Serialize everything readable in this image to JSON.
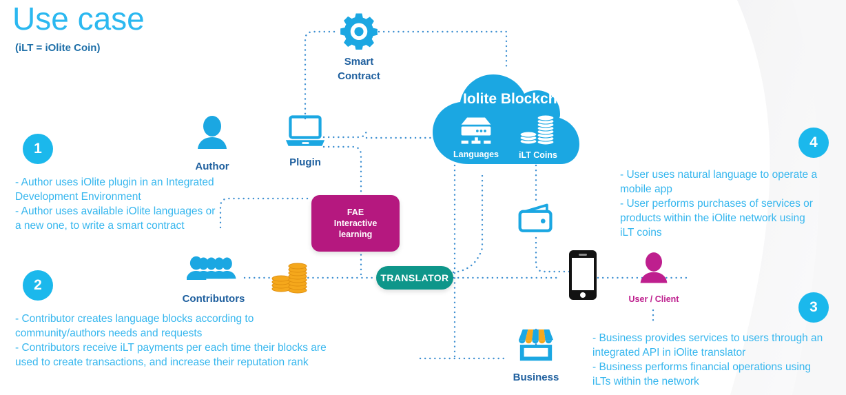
{
  "header": {
    "title": "Use case",
    "subtitle": "(iLT = iOlite Coin)"
  },
  "colors": {
    "title_blue": "#2BB8F0",
    "subtitle_blue": "#1E6FA8",
    "badge_cyan": "#1BB8EC",
    "body_text_blue": "#35B6EE",
    "node_label_blue": "#1E5F9E",
    "cloud_blue": "#1BA7E2",
    "fae_magenta": "#B5187F",
    "translator_teal": "#0E968A",
    "coin_orange": "#F5A81C",
    "user_magenta": "#BE1F8E",
    "phone_black": "#1A1A1A",
    "connector_blue": "#3D8FD1"
  },
  "steps": [
    {
      "number": "1",
      "lines": [
        "- Author uses iOlite plugin in an Integrated",
        "Development Environment",
        "- Author uses available iOlite languages or",
        "a new one, to write a smart contract"
      ]
    },
    {
      "number": "2",
      "lines": [
        "- Contributor creates language blocks according to",
        "community/authors needs and requests",
        "- Contributors receive iLT payments per each time their blocks are",
        "used to create transactions, and increase their reputation rank"
      ]
    },
    {
      "number": "3",
      "lines": [
        "- Business provides services to users through an",
        "integrated API in iOlite translator",
        "- Business performs financial operations using",
        "iLTs within the network"
      ]
    },
    {
      "number": "4",
      "lines": [
        "- User uses natural language to operate a",
        "mobile app",
        "- User performs purchases of services or",
        "products within the iOlite network using",
        "iLT coins"
      ]
    }
  ],
  "nodes": {
    "smart_contract": {
      "label_line1": "Smart",
      "label_line2": "Contract",
      "icon": "gear-icon"
    },
    "author": {
      "label": "Author",
      "icon": "person-icon"
    },
    "plugin": {
      "label": "Plugin",
      "icon": "laptop-icon"
    },
    "contributors": {
      "label": "Contributors",
      "icon": "people-group-icon"
    },
    "coins": {
      "icon": "coin-stack-icon"
    },
    "wallet": {
      "icon": "wallet-icon"
    },
    "phone": {
      "icon": "smartphone-icon"
    },
    "user_client": {
      "label": "User / Client",
      "icon": "person-icon"
    },
    "business": {
      "label": "Business",
      "icon": "storefront-icon"
    }
  },
  "cloud": {
    "title": "Iolite Blockchain",
    "items": [
      {
        "label": "Languages",
        "icon": "server-database-icon"
      },
      {
        "label": "iLT Coins",
        "icon": "coin-stack-icon"
      }
    ]
  },
  "fae_box": {
    "line1": "FAE",
    "line2": "Interactive",
    "line3": "learning"
  },
  "translator": {
    "label": "TRANSLATOR"
  }
}
